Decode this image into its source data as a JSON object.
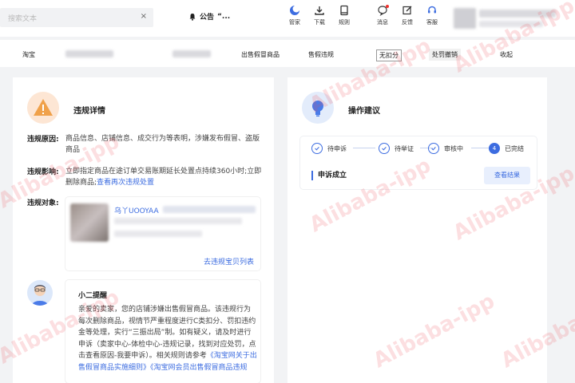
{
  "search": {
    "placeholder": "搜索文本",
    "clear": "×"
  },
  "notice": {
    "label": "公告",
    "text": "“..."
  },
  "toolbar": [
    {
      "id": "manager",
      "label": "管家",
      "icon": "moon-icon"
    },
    {
      "id": "download",
      "label": "下载",
      "icon": "download-icon"
    },
    {
      "id": "rules",
      "label": "规则",
      "icon": "book-icon"
    },
    {
      "id": "messages",
      "label": "消息",
      "icon": "chat-icon"
    },
    {
      "id": "feedback",
      "label": "反馈",
      "icon": "edit-icon"
    },
    {
      "id": "service",
      "label": "客服",
      "icon": "headset-icon"
    }
  ],
  "inforow": {
    "platform": "淘宝",
    "type": "出售假冒商品",
    "category": "售假违规",
    "score": "无扣分",
    "penalty": "处罚撤销",
    "link": "收起"
  },
  "left": {
    "title": "违规详情",
    "reason_label": "违规原因:",
    "reason_text": "商品信息、店铺信息、成交行为等表明，涉嫌发布假冒、盗版商品",
    "impact_label": "违规影响:",
    "impact_text": "立即指定商品在途订单交易账期延长处置点持续360小时;立即删除商品;",
    "impact_link": "查看再次违规处置",
    "target_label": "违规对象:",
    "item_name": "乌丫UOOYAA",
    "item_link": "去违规宝贝列表",
    "tip_title": "小二提醒",
    "tip_text": "亲爱的卖家，您的店铺涉嫌出售假冒商品。该违规行为每次删除商品，视情节严重程度进行C类扣分、罚扣违约金等处理，实行“三振出局”制。如有疑义，请及时进行申诉（卖家中心-体检中心-违规记录，找到对应处罚，点击查看原因-我要申诉）。相关规则请参考",
    "tip_link": "《淘宝网关于出售假冒商品实施细则》《淘宝网会员出售假冒商品违规"
  },
  "right": {
    "title": "操作建议",
    "steps": [
      {
        "label": "待申诉",
        "state": "done"
      },
      {
        "label": "待举证",
        "state": "done"
      },
      {
        "label": "审核中",
        "state": "done"
      },
      {
        "label": "已完结",
        "state": "current",
        "num": "4"
      }
    ],
    "result": "申诉成立",
    "view_button": "查看结果"
  },
  "watermark": "Alibaba-ipp",
  "colors": {
    "accent": "#3c6ce0",
    "warn": "#f0a14a",
    "bg": "#f2f3f5"
  }
}
